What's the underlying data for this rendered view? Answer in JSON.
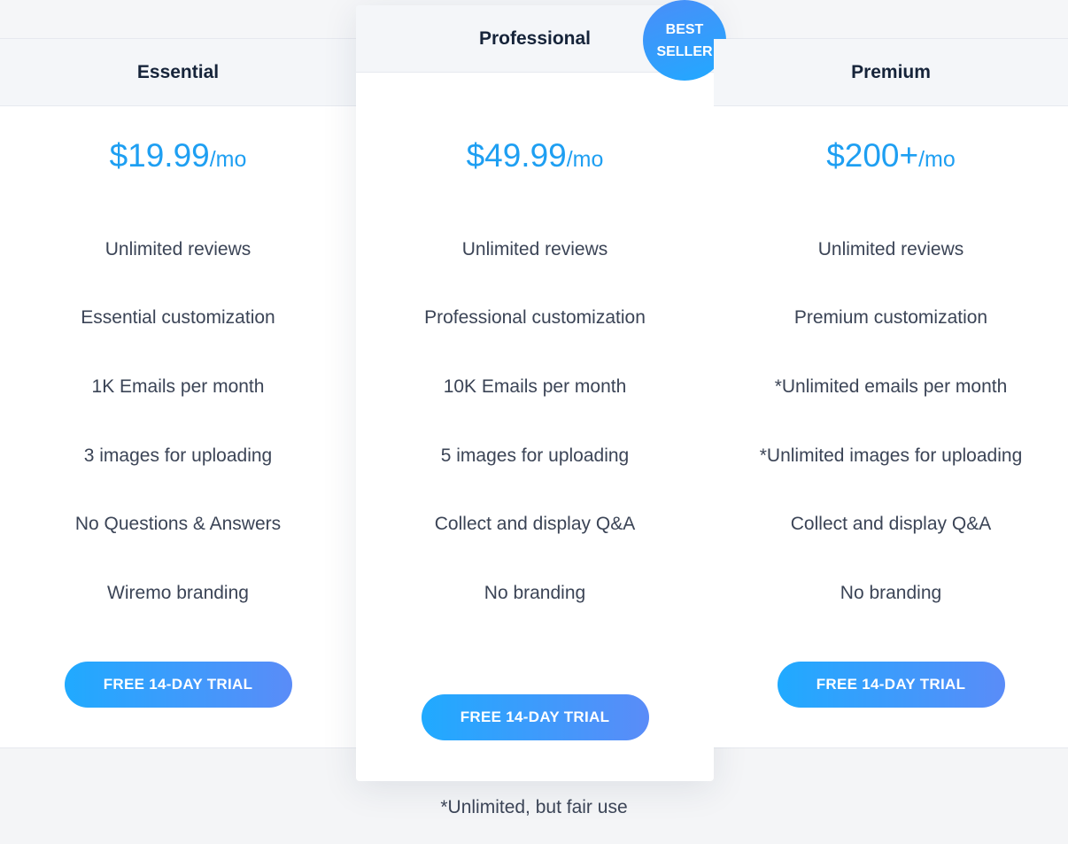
{
  "plans": [
    {
      "name": "Essential",
      "price": "$19.99",
      "period": "/mo",
      "features": [
        "Unlimited reviews",
        "Essential customization",
        "1K Emails per month",
        "3 images for uploading",
        "No Questions & Answers",
        "Wiremo branding"
      ],
      "cta": "FREE 14-DAY TRIAL"
    },
    {
      "name": "Professional",
      "price": "$49.99",
      "period": "/mo",
      "features": [
        "Unlimited reviews",
        "Professional customization",
        "10K Emails per month",
        "5 images for uploading",
        "Collect and display Q&A",
        "No branding"
      ],
      "cta": "FREE 14-DAY TRIAL",
      "badge": [
        "BEST",
        "SELLER"
      ]
    },
    {
      "name": "Premium",
      "price": "$200+",
      "period": "/mo",
      "features": [
        "Unlimited reviews",
        "Premium customization",
        "*Unlimited emails per month",
        "*Unlimited images for uploading",
        "Collect and display Q&A",
        "No branding"
      ],
      "cta": "FREE 14-DAY TRIAL"
    }
  ],
  "footnote": "*Unlimited, but fair use",
  "colors": {
    "accent": "#1e9ff2",
    "button_start": "#20aaff",
    "button_end": "#5a8cf8",
    "heading": "#16243a",
    "text": "#3b4456"
  }
}
